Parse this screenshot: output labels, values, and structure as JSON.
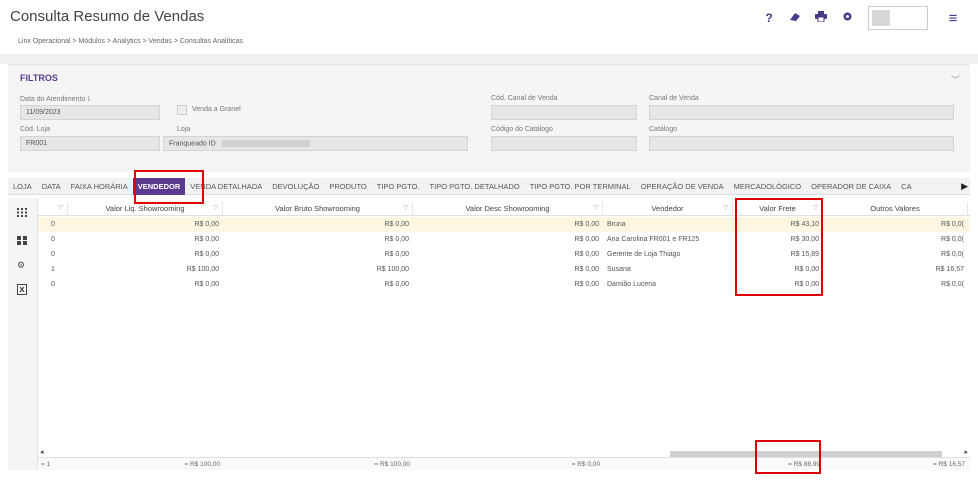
{
  "header": {
    "title": "Consulta Resumo de Vendas",
    "icons": {
      "help": "?",
      "eraser": "eraser-icon",
      "print": "print-icon",
      "settings": "gear-icon",
      "menu": "≡"
    }
  },
  "breadcrumb": "Linx Operacional > Módulos > Analytics > Vendas > Consultas Analíticas",
  "filters": {
    "title": "FILTROS",
    "data_atendimento_label": "Data do Atendimento",
    "data_atendimento_value": "11/09/2023",
    "venda_granel_label": "Venda a Granel",
    "cod_canal_label": "Cód. Canal de Venda",
    "canal_label": "Canal de Venda",
    "cod_loja_label": "Cód. Loja",
    "cod_loja_value": "FR001",
    "loja_label": "Loja",
    "loja_value": "Franqueado ID",
    "cod_catalogo_label": "Código do Catálogo",
    "catalogo_label": "Catálogo"
  },
  "tabs": [
    "LOJA",
    "DATA",
    "FAIXA HORÁRIA",
    "VENDEDOR",
    "VENDA DETALHADA",
    "DEVOLUÇÃO",
    "PRODUTO",
    "TIPO PGTO.",
    "TIPO PGTO. DETALHADO",
    "TIPO PGTO. POR TERMINAL",
    "OPERAÇÃO DE VENDA",
    "MERCADOLÓGICO",
    "OPERADOR DE CAIXA",
    "CA"
  ],
  "active_tab": "VENDEDOR",
  "grid": {
    "columns": [
      "",
      "Valor Liq. Showrooming",
      "Valor Bruto Showrooming",
      "Valor Desc Showrooming",
      "Vendedor",
      "Valor Frete",
      "Outros Valores"
    ],
    "rows": [
      [
        "0",
        "R$ 0,00",
        "R$ 0,00",
        "R$ 0,00",
        "Bruna",
        "R$ 43,10",
        "R$ 0,0("
      ],
      [
        "0",
        "R$ 0,00",
        "R$ 0,00",
        "R$ 0,00",
        "Ana Carolina FR001 e FR125",
        "R$ 30,00",
        "R$ 0,0("
      ],
      [
        "0",
        "R$ 0,00",
        "R$ 0,00",
        "R$ 0,00",
        "Gerente de Loja Thiago",
        "R$ 15,89",
        "R$ 0,0("
      ],
      [
        "1",
        "R$ 100,00",
        "R$ 100,00",
        "R$ 0,00",
        "Susana",
        "R$ 0,00",
        "R$ 16,57"
      ],
      [
        "0",
        "R$ 0,00",
        "R$ 0,00",
        "R$ 0,00",
        "Damião Lucena",
        "R$ 0,00",
        "R$ 0,0("
      ]
    ],
    "footer": [
      "= 1",
      "= R$ 100,00",
      "= R$ 100,00",
      "= R$ 0,00",
      "",
      "= R$ 88,99",
      "= R$ 16,57"
    ]
  }
}
